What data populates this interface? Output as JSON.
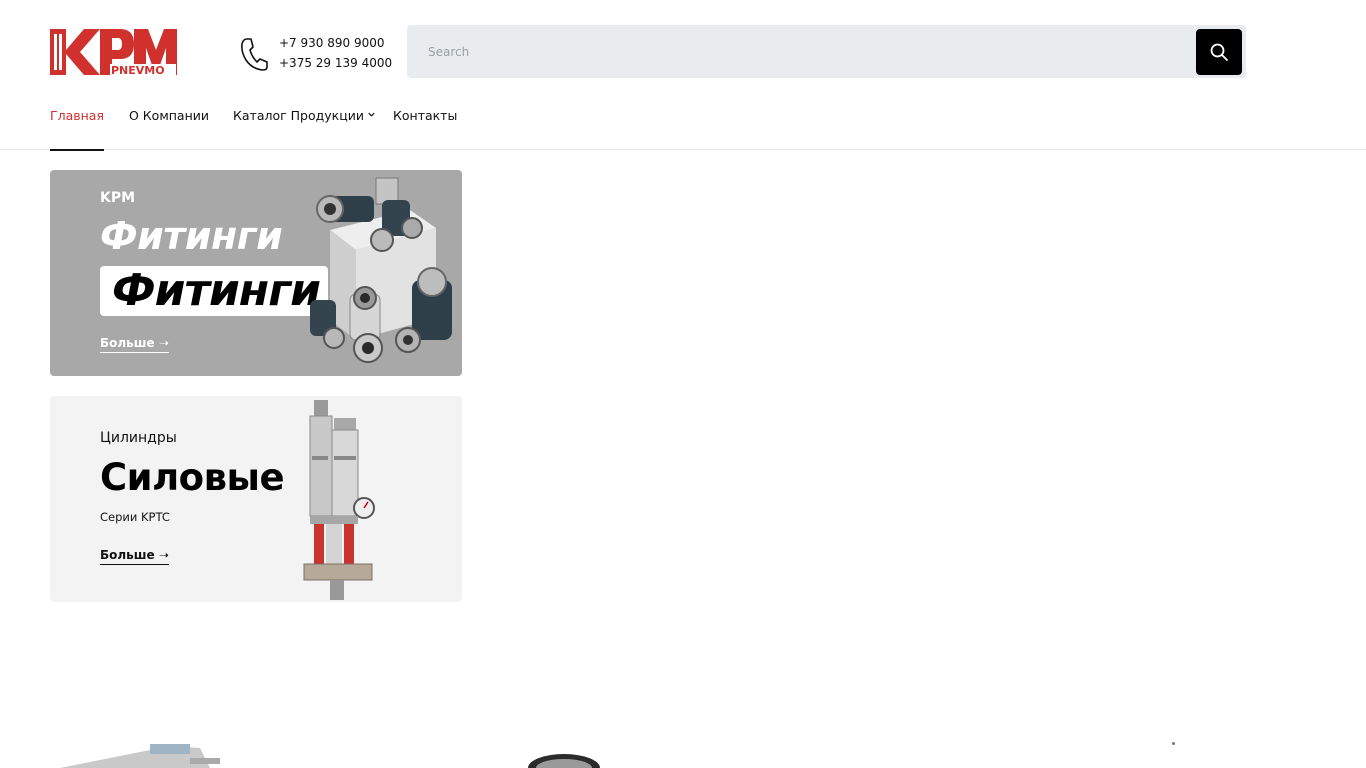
{
  "header": {
    "logo_text": "KPM",
    "logo_subtext": "PNEVMO",
    "phones": [
      "+7 930 890 9000",
      "+375 29 139 4000"
    ],
    "search": {
      "placeholder": "Search"
    }
  },
  "nav": {
    "items": [
      {
        "label": "Главная",
        "active": true
      },
      {
        "label": "О Компании",
        "active": false
      },
      {
        "label": "Каталог Продукции",
        "active": false,
        "has_dropdown": true
      },
      {
        "label": "Контакты",
        "active": false
      }
    ]
  },
  "banners": {
    "fittings": {
      "brand": "KPM",
      "title": "Фитинги",
      "title_boxed": "Фитинги",
      "more": "Больше ➝"
    },
    "cylinders": {
      "subtitle": "Цилиндры",
      "title": "Силовые",
      "series": "Серии KPTC",
      "more": "Больше ➝"
    }
  },
  "colors": {
    "accent": "#d0312d",
    "search_bg": "#e9ecef",
    "fittings_banner_bg": "#a8a8a8",
    "cylinders_banner_bg": "#f3f3f3"
  },
  "icons": {
    "phone": "phone-icon",
    "search": "search-icon",
    "dropdown": "chevron-down-icon",
    "arrow": "arrow-right-icon"
  }
}
